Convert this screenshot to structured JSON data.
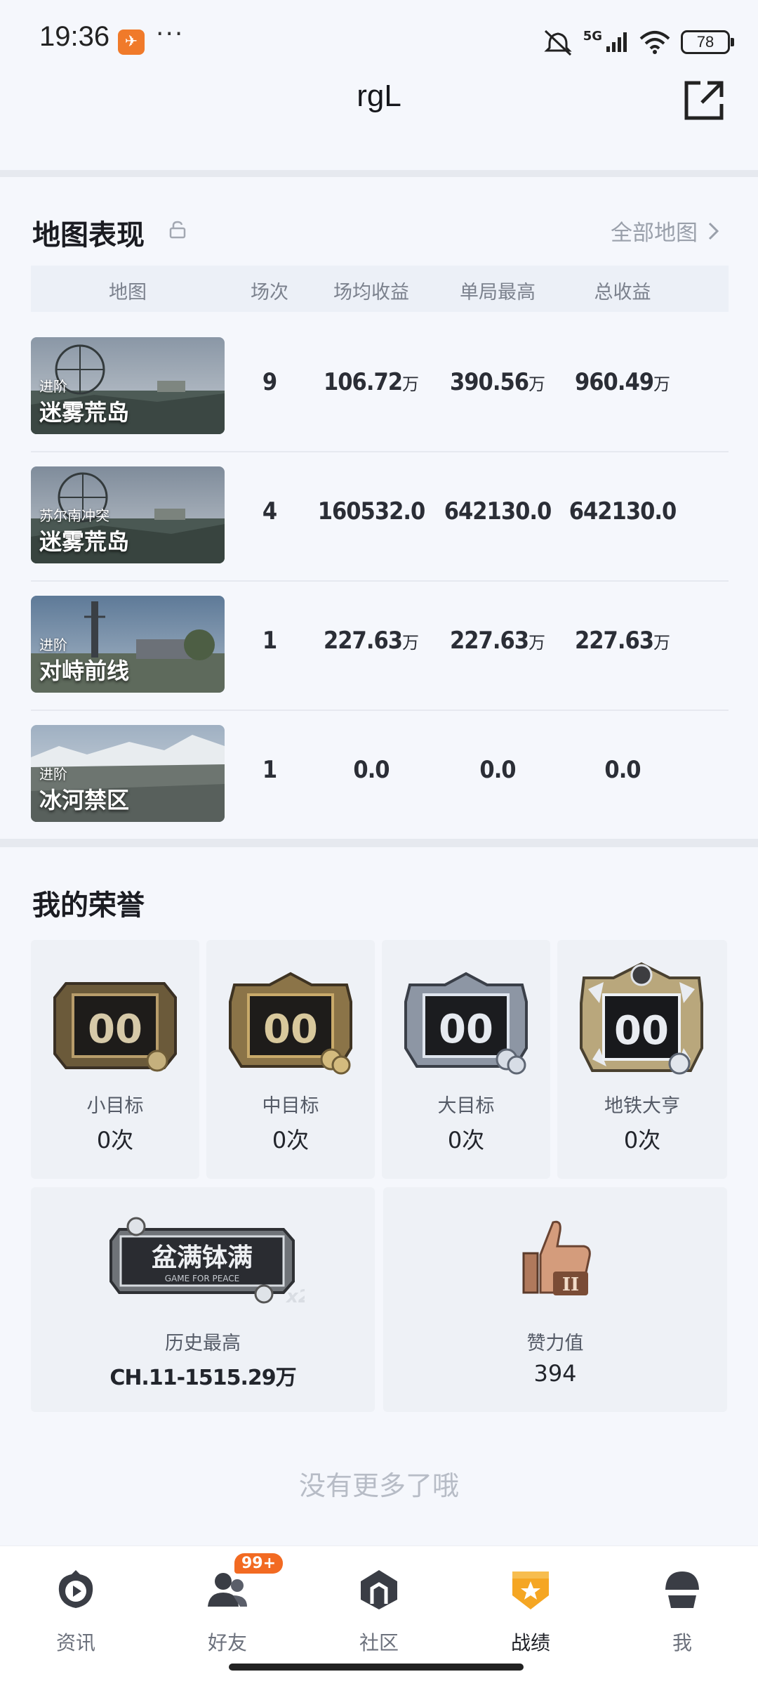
{
  "status_bar": {
    "time": "19:36",
    "app_icon": "game-app-icon",
    "more": "···",
    "network": "5G",
    "battery": "78"
  },
  "header": {
    "title": "rgL",
    "share_icon": "share-icon"
  },
  "map_performance": {
    "title": "地图表现",
    "all_maps_link": "全部地图",
    "columns": [
      "地图",
      "场次",
      "场均收益",
      "单局最高",
      "总收益"
    ],
    "rows": [
      {
        "mode": "进阶",
        "name": "迷雾荒岛",
        "count": "9",
        "avg": "106.72",
        "avg_unit": "万",
        "max": "390.56",
        "max_unit": "万",
        "total": "960.49",
        "total_unit": "万"
      },
      {
        "mode": "苏尔南冲突",
        "name": "迷雾荒岛",
        "count": "4",
        "avg": "160532.0",
        "avg_unit": "",
        "max": "642130.0",
        "max_unit": "",
        "total": "642130.0",
        "total_unit": ""
      },
      {
        "mode": "进阶",
        "name": "对峙前线",
        "count": "1",
        "avg": "227.63",
        "avg_unit": "万",
        "max": "227.63",
        "max_unit": "万",
        "total": "227.63",
        "total_unit": "万"
      },
      {
        "mode": "进阶",
        "name": "冰河禁区",
        "count": "1",
        "avg": "0.0",
        "avg_unit": "",
        "max": "0.0",
        "max_unit": "",
        "total": "0.0",
        "total_unit": ""
      }
    ]
  },
  "honors": {
    "title": "我的荣誉",
    "targets": [
      {
        "label": "小目标",
        "value": "0次",
        "badge_text": "00"
      },
      {
        "label": "中目标",
        "value": "0次",
        "badge_text": "00"
      },
      {
        "label": "大目标",
        "value": "0次",
        "badge_text": "00"
      },
      {
        "label": "地铁大亨",
        "value": "0次",
        "badge_text": "00"
      }
    ],
    "history": {
      "badge_text": "盆满钵满",
      "badge_sub": "GAME FOR PEACE",
      "badge_multiplier": "x2",
      "label": "历史最高",
      "value": "CH.11-1515.29万"
    },
    "likes": {
      "badge_level": "II",
      "label": "赞力值",
      "value": "394"
    }
  },
  "footer_note": "没有更多了哦",
  "bottom_nav": {
    "items": [
      {
        "label": "资讯",
        "icon": "news-icon"
      },
      {
        "label": "好友",
        "icon": "friends-icon",
        "badge": "99+"
      },
      {
        "label": "社区",
        "icon": "community-icon"
      },
      {
        "label": "战绩",
        "icon": "record-icon",
        "active": true
      },
      {
        "label": "我",
        "icon": "profile-icon"
      }
    ]
  },
  "colors": {
    "accent": "#f5a623",
    "badge_orange": "#f26a22",
    "background": "#f5f7fc"
  }
}
